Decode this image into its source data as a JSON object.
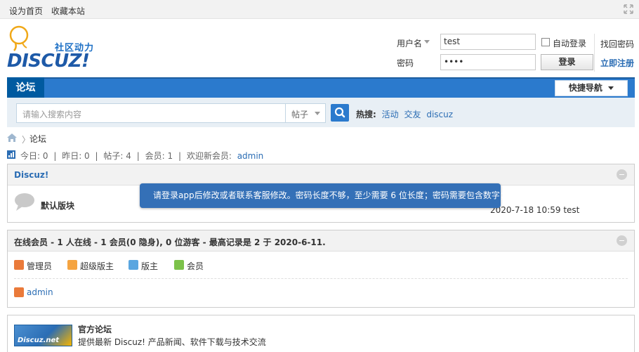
{
  "topbar": {
    "set_home": "设为首页",
    "bookmark": "收藏本站"
  },
  "logo": {
    "slogan": "社区动力",
    "word": "DISCUZ!"
  },
  "login": {
    "username_label": "用户名",
    "username_value": "test",
    "password_label": "密码",
    "password_value": "••••",
    "auto_login": "自动登录",
    "login_button": "登录",
    "forgot_password": "找回密码",
    "register": "立即注册"
  },
  "nav": {
    "forum_tab": "论坛",
    "quick_nav": "快捷导航"
  },
  "search": {
    "placeholder": "请输入搜索内容",
    "type": "帖子",
    "hot_label": "热搜:",
    "hot_links": [
      "活动",
      "交友",
      "discuz"
    ]
  },
  "breadcrumb": {
    "current": "论坛"
  },
  "stats": {
    "today": "今日: 0",
    "yesterday": "昨日: 0",
    "posts": "帖子: 4",
    "members": "会员: 1",
    "welcome": "欢迎新会员:",
    "new_member": "admin",
    "sep": "|"
  },
  "category": {
    "title": "Discuz!",
    "forum_name": "默认版块",
    "last_post": "2020-7-18 10:59 test"
  },
  "online": {
    "title": "在线会员 - 1 人在线 - 1 会员(0 隐身), 0 位游客 - 最高记录是 2 于 2020-6-11.",
    "legend": [
      "管理员",
      "超级版主",
      "版主",
      "会员"
    ],
    "legend_colors": [
      "#ea7a3a",
      "#f5a441",
      "#5aa6e0",
      "#7cc24a"
    ],
    "user": "admin"
  },
  "links": {
    "banner_text": "Discuz.net",
    "name": "官方论坛",
    "desc": "提供最新 Discuz! 产品新闻、软件下载与技术交流"
  },
  "toast": {
    "message": "请登录app后修改或者联系客服修改。密码长度不够，至少需要 6 位长度；密码需要包含数字；"
  }
}
